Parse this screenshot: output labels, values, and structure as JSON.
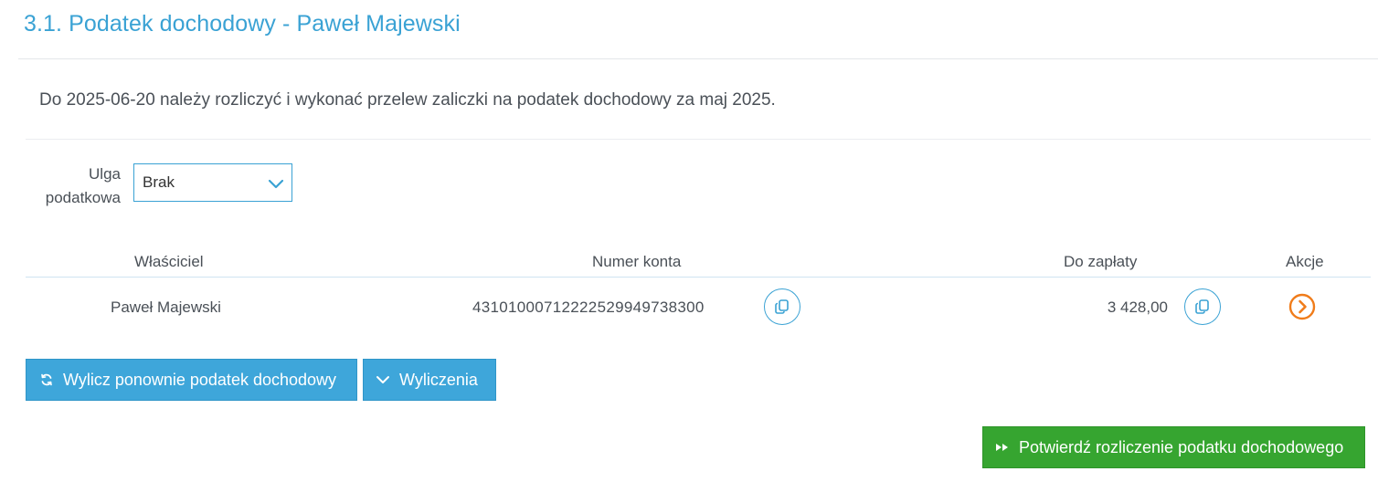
{
  "header": {
    "title": "3.1. Podatek dochodowy - Paweł Majewski"
  },
  "notice": {
    "text": "Do 2025-06-20 należy rozliczyć i wykonać przelew zaliczki na podatek dochodowy za maj 2025."
  },
  "ulga": {
    "label_line1": "Ulga",
    "label_line2": "podatkowa",
    "selected": "Brak",
    "icon": "chevron-down-icon"
  },
  "table": {
    "headers": {
      "owner": "Właściciel",
      "account": "Numer konta",
      "due": "Do zapłaty",
      "actions": "Akcje"
    },
    "rows": [
      {
        "owner": "Paweł Majewski",
        "account": "43101000712222529949738300",
        "amount": "3 428,00"
      }
    ]
  },
  "buttons": {
    "recalc": "Wylicz ponownie podatek dochodowy",
    "calculations": "Wyliczenia",
    "confirm": "Potwierdź rozliczenie podatku dochodowego"
  },
  "colors": {
    "accent": "#3aa2d4",
    "button_blue": "#3ea6da",
    "button_green": "#36a530",
    "action_orange": "#f07c1a"
  }
}
